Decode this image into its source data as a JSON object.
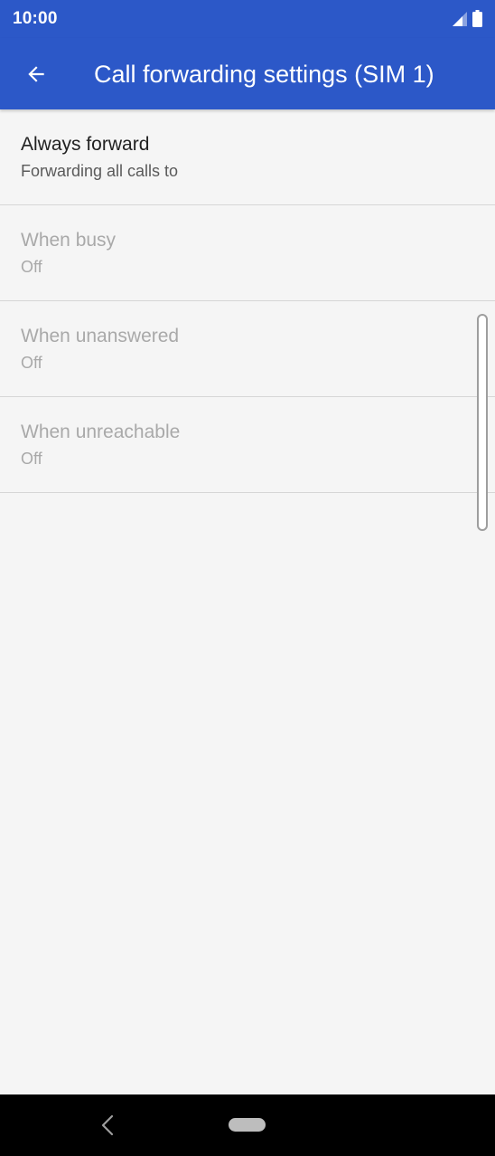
{
  "status_bar": {
    "time": "10:00",
    "icons": [
      "signal-icon",
      "battery-icon"
    ]
  },
  "app_bar": {
    "back_icon": "arrow-back-icon",
    "title": "Call forwarding settings (SIM 1)"
  },
  "settings": [
    {
      "title": "Always forward",
      "summary": "Forwarding all calls to",
      "enabled": true
    },
    {
      "title": "When busy",
      "summary": "Off",
      "enabled": false
    },
    {
      "title": "When unanswered",
      "summary": "Off",
      "enabled": false
    },
    {
      "title": "When unreachable",
      "summary": "Off",
      "enabled": false
    }
  ],
  "nav_bar": {
    "back_icon": "nav-back-icon",
    "home_icon": "home-pill-icon"
  },
  "colors": {
    "accent": "#2c58c8",
    "background": "#f5f5f5",
    "text_primary": "#222222",
    "text_secondary": "#5a5a5a",
    "text_disabled": "#a9a9a9",
    "divider": "#d6d6d6"
  }
}
